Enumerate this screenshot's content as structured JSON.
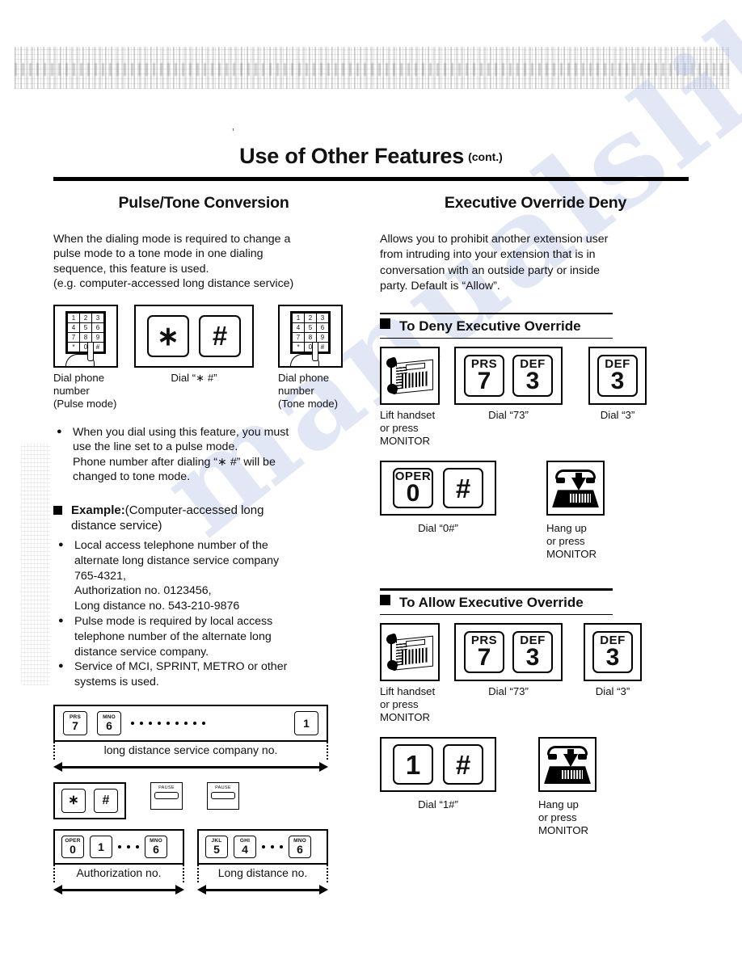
{
  "page": {
    "header": {
      "title": "Use of Other Features",
      "continuation": "(cont.)",
      "tick_mark": "’"
    },
    "watermark_text": "manualslib.com"
  },
  "left_column": {
    "section_title": "Pulse/Tone Conversion",
    "intro_lines": [
      "When the dialing mode is required to change a",
      "pulse mode to a tone mode in one dialing",
      "sequence, this feature is used.",
      "(e.g. computer-accessed long distance service)"
    ],
    "steps": [
      {
        "caption_lines": [
          "Dial phone",
          "number",
          "(Pulse mode)"
        ],
        "icon": "keypad-hand-icon"
      },
      {
        "caption_lines": [
          "Dial “∗ #”"
        ],
        "keys": [
          "∗",
          "#"
        ]
      },
      {
        "caption_lines": [
          "Dial phone",
          "number",
          "(Tone mode)"
        ],
        "icon": "keypad-hand-icon"
      }
    ],
    "note_bullet": [
      "When you dial using this feature, you must",
      "use the line set to a pulse mode.",
      "Phone number after dialing “∗ #” will be",
      "changed to tone mode."
    ],
    "example_heading_bold": "Example:",
    "example_heading_rest": "(Computer-accessed long",
    "example_heading_line2": "distance service)",
    "example_bullets": [
      [
        "Local access telephone number of the",
        "alternate long distance service company",
        "765-4321,",
        "Authorization no. 0123456,",
        "Long distance no. 543-210-9876"
      ],
      [
        "Pulse mode is required by local access",
        "telephone number of the alternate long",
        "distance service company."
      ],
      [
        "Service of MCI, SPRINT, METRO or other",
        "systems is used."
      ]
    ],
    "sequence_1": {
      "keys": [
        {
          "lbl": "PRS",
          "num": "7"
        },
        {
          "lbl": "MNO",
          "num": "6"
        },
        {
          "dots": 9
        },
        {
          "lbl": "",
          "num": "1"
        }
      ],
      "measure_label": "long distance service company no."
    },
    "sequence_2": {
      "keys": [
        {
          "lbl": "",
          "glyph": "∗"
        },
        {
          "lbl": "",
          "glyph": "#"
        }
      ],
      "pause_keys": [
        "PAUSE",
        "PAUSE"
      ]
    },
    "sequence_3": {
      "keys": [
        {
          "lbl": "OPER",
          "num": "0"
        },
        {
          "lbl": "",
          "num": "1"
        },
        {
          "dots": 3
        },
        {
          "lbl": "MNO",
          "num": "6"
        }
      ],
      "measure_label": "Authorization no."
    },
    "sequence_4": {
      "keys": [
        {
          "lbl": "JKL",
          "num": "5"
        },
        {
          "lbl": "GHI",
          "num": "4"
        },
        {
          "dots": 3
        },
        {
          "lbl": "MNO",
          "num": "6"
        }
      ],
      "measure_label": "Long distance no."
    }
  },
  "right_column": {
    "section_title": "Executive Override Deny",
    "intro_lines": [
      "Allows you to prohibit another extension user",
      "from intruding into your extension that is in",
      "conversation with an outside party or inside",
      "party.  Default is “Allow”."
    ],
    "deny": {
      "heading": "To Deny Executive Override",
      "steps": [
        {
          "icon": "lift-handset-icon",
          "caption_lines": [
            "Lift handset",
            "or press",
            "MONITOR"
          ]
        },
        {
          "keys": [
            {
              "lbl": "PRS",
              "num": "7"
            },
            {
              "lbl": "DEF",
              "num": "3"
            }
          ],
          "caption_lines": [
            "Dial “73”"
          ]
        },
        {
          "keys": [
            {
              "lbl": "DEF",
              "num": "3"
            }
          ],
          "caption_lines": [
            "Dial “3”"
          ]
        },
        {
          "keys": [
            {
              "lbl": "OPER",
              "num": "0"
            },
            {
              "glyph": "#"
            }
          ],
          "caption_lines": [
            "Dial “0#”"
          ]
        },
        {
          "icon": "hang-up-icon",
          "caption_lines": [
            "Hang up",
            "or press",
            "MONITOR"
          ]
        }
      ]
    },
    "allow": {
      "heading": "To Allow Executive Override",
      "steps": [
        {
          "icon": "lift-handset-icon",
          "caption_lines": [
            "Lift handset",
            "or press",
            "MONITOR"
          ]
        },
        {
          "keys": [
            {
              "lbl": "PRS",
              "num": "7"
            },
            {
              "lbl": "DEF",
              "num": "3"
            }
          ],
          "caption_lines": [
            "Dial “73”"
          ]
        },
        {
          "keys": [
            {
              "lbl": "DEF",
              "num": "3"
            }
          ],
          "caption_lines": [
            "Dial “3”"
          ]
        },
        {
          "keys": [
            {
              "glyph": "1"
            },
            {
              "glyph": "#"
            }
          ],
          "caption_lines": [
            "Dial “1#”"
          ]
        },
        {
          "icon": "hang-up-icon",
          "caption_lines": [
            "Hang up",
            "or press",
            "MONITOR"
          ]
        }
      ]
    }
  }
}
